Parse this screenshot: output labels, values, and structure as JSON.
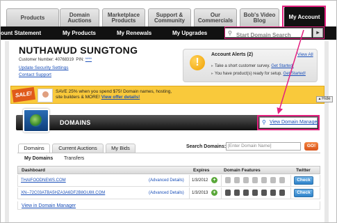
{
  "topnav": {
    "tabs": [
      {
        "label": "Products",
        "active": false
      },
      {
        "label": "Domain Auctions",
        "active": false
      },
      {
        "label": "Marketplace Products",
        "active": false
      },
      {
        "label": "Support & Community",
        "active": false
      },
      {
        "label": "Our Commercials",
        "active": false
      },
      {
        "label": "Bob's Video Blog",
        "active": false
      },
      {
        "label": "My Account",
        "active": true
      }
    ]
  },
  "subnav": {
    "items": [
      "ount Statement",
      "My Products",
      "My Renewals",
      "My Upgrades"
    ],
    "search_placeholder": "Start Domain Search",
    "search_button": "▸"
  },
  "account": {
    "name": "NUTHAWUD SUNGTONG",
    "customer_label": "Customer Number:",
    "customer_number": "40768319",
    "pin_label": "PIN:",
    "pin_value": "****",
    "update_security": "Update Security Settings",
    "contact_support": "Contact Support"
  },
  "alerts": {
    "title": "Account Alerts (2)",
    "view_all": "View All",
    "lines": [
      {
        "text": "Take a short customer survey.",
        "link": "Get Started!"
      },
      {
        "text": "You have product(s) ready for setup.",
        "link": "Get Started!"
      }
    ]
  },
  "promo": {
    "badge": "SALE!",
    "line1": "SAVE 25% when you spend $75! Domain names, hosting,",
    "line2": "site builders & MORE!",
    "link": "View offer details!",
    "hide": "Hide"
  },
  "domains": {
    "title": "DOMAINS",
    "manager_link": "View Domain Manager",
    "tabs": [
      "Domains",
      "Current Auctions",
      "My Bids"
    ],
    "search_label": "Search Domains:",
    "search_placeholder": "[Enter Domain Name]",
    "go": "GO!",
    "subtabs": [
      "My Domains",
      "Transfers"
    ],
    "columns": [
      "Dashboard",
      "Expires",
      "Domain Features",
      "Twitter"
    ],
    "rows": [
      {
        "domain": "THAIFOODNEWS.COM",
        "advanced": "(Advanced Details)",
        "expires": "1/3/2012",
        "twitter": "Check"
      },
      {
        "domain": "XN--72C03ATBA5HZA3A6DF2B8GU8II.COM",
        "advanced": "(Advanced Details)",
        "expires": "1/3/2013",
        "twitter": "Check"
      }
    ],
    "view_in_manager": "View in Domain Manager"
  },
  "colors": {
    "highlight": "#e3207f",
    "subnav_bg": "#111111",
    "promo_bg": "#f9c93b",
    "link": "#1a4fb8"
  }
}
